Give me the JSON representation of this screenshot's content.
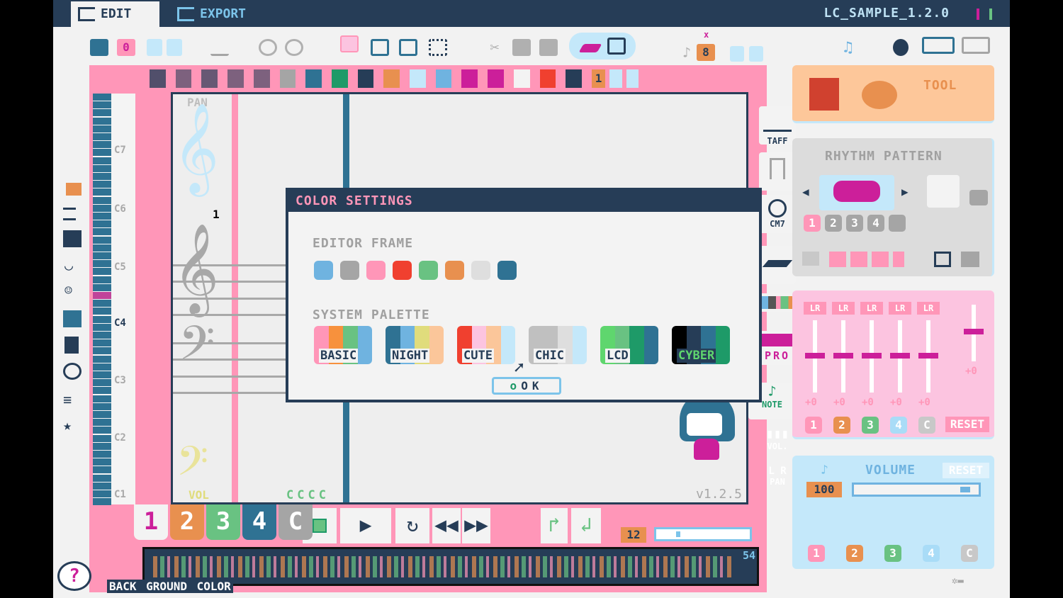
{
  "tabs": {
    "edit": "EDIT",
    "export": "EXPORT"
  },
  "project_title": "LC_SAMPLE_1.2.0",
  "toolbar": {
    "track_number": "0",
    "note_length": "8",
    "note_length_marker": "x"
  },
  "instrument_bar": {
    "number": "1"
  },
  "editor": {
    "pan_label": "PAN",
    "vol_label": "VOL",
    "measure_number": "1",
    "version": "v1.2.5",
    "chord_marks": "CCCC",
    "octaves": [
      "C7",
      "C6",
      "C5",
      "C4",
      "C3",
      "C2",
      "C1"
    ]
  },
  "side_buttons": {
    "staff": "TAFF",
    "cm7": "CM7",
    "pro": "PRO",
    "note": "NOTE",
    "vol": "VOL.",
    "pan": "PAN",
    "lr": "L R"
  },
  "dialog": {
    "title": "COLOR SETTINGS",
    "editor_frame_label": "EDITOR FRAME",
    "editor_frame_colors": [
      "#6fb3e0",
      "#a5a5a5",
      "#ff96b8",
      "#f0402f",
      "#69c282",
      "#e8904f",
      "#dedede",
      "#2f7293"
    ],
    "system_palette_label": "SYSTEM PALETTE",
    "palettes": [
      {
        "name": "BASIC",
        "colors": [
          "#ff96b8",
          "#f7913d",
          "#69c282",
          "#6fb3e0"
        ]
      },
      {
        "name": "NIGHT",
        "colors": [
          "#2f7293",
          "#6fb3e0",
          "#e0dc7c",
          "#fbc69a"
        ]
      },
      {
        "name": "CUTE",
        "colors": [
          "#f0402f",
          "#fcc4e0",
          "#fbc69a",
          "#c4e8fa"
        ]
      },
      {
        "name": "CHIC",
        "colors": [
          "#c0c0c0",
          "#c0c0c0",
          "#dedede",
          "#c4e8fa"
        ]
      },
      {
        "name": "LCD",
        "colors": [
          "#5fd66e",
          "#69c282",
          "#1e9a68",
          "#2f7293"
        ]
      },
      {
        "name": "CYBER",
        "colors": [
          "#000000",
          "#263d57",
          "#2f7293",
          "#1e9a68"
        ]
      }
    ],
    "ok_label": "OK"
  },
  "channels": [
    {
      "label": "1",
      "color": "#f3f3f3",
      "text": "#cc1f9a"
    },
    {
      "label": "2",
      "color": "#e8904f",
      "text": "#ffffff"
    },
    {
      "label": "3",
      "color": "#69c282",
      "text": "#ffffff"
    },
    {
      "label": "4",
      "color": "#2f7293",
      "text": "#ffffff"
    },
    {
      "label": "C",
      "color": "#a5a5a5",
      "text": "#ffffff"
    }
  ],
  "transport": {
    "tempo": "12",
    "timeline_end": "54"
  },
  "status_hint": "BACK GROUND COLOR",
  "tool_panel": {
    "title": "TOOL"
  },
  "rhythm": {
    "title": "RHYTHM PATTERN",
    "patterns": [
      "1",
      "2",
      "3",
      "4"
    ],
    "selected": "1"
  },
  "mixer": {
    "lr_label": "LR",
    "values": [
      "+0",
      "+0",
      "+0",
      "+0",
      "+0"
    ],
    "master_value": "+0",
    "channels": [
      "1",
      "2",
      "3",
      "4",
      "C"
    ],
    "reset": "RESET"
  },
  "volume": {
    "title": "VOLUME",
    "reset": "RESET",
    "value": "100",
    "level_percent": 100,
    "channels": [
      "1",
      "2",
      "3",
      "4",
      "C"
    ]
  },
  "colors": {
    "navy": "#263d57",
    "pink": "#ff96b8",
    "accent_magenta": "#cc1f9a"
  }
}
